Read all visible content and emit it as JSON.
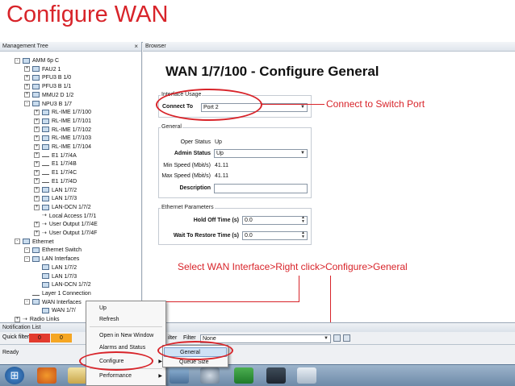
{
  "slide_title": "Configure WAN",
  "tree": {
    "header": "Management Tree",
    "close_glyph": "×",
    "items": [
      {
        "label": "AMM 6p C",
        "indent": 1,
        "exp": "-"
      },
      {
        "label": "FAU2 1",
        "indent": 2,
        "exp": "+"
      },
      {
        "label": "PFU3 B 1/0",
        "indent": 2,
        "exp": "+"
      },
      {
        "label": "PFU3 B 1/1",
        "indent": 2,
        "exp": "+"
      },
      {
        "label": "MMU2 D 1/2",
        "indent": 2,
        "exp": "+"
      },
      {
        "label": "NPU3 B 1/7",
        "indent": 2,
        "exp": "-"
      },
      {
        "label": "RL-IME 1/7/100",
        "indent": 3,
        "exp": "+"
      },
      {
        "label": "RL-IME 1/7/101",
        "indent": 3,
        "exp": "+"
      },
      {
        "label": "RL-IME 1/7/102",
        "indent": 3,
        "exp": "+"
      },
      {
        "label": "RL-IME 1/7/103",
        "indent": 3,
        "exp": "+"
      },
      {
        "label": "RL-IME 1/7/104",
        "indent": 3,
        "exp": "+"
      },
      {
        "label": "E1 1/7/4A",
        "indent": 3,
        "exp": "+",
        "icon": "line"
      },
      {
        "label": "E1 1/7/4B",
        "indent": 3,
        "exp": "+",
        "icon": "line"
      },
      {
        "label": "E1 1/7/4C",
        "indent": 3,
        "exp": "+",
        "icon": "line"
      },
      {
        "label": "E1 1/7/4D",
        "indent": 3,
        "exp": "+",
        "icon": "line"
      },
      {
        "label": "LAN 1/7/2",
        "indent": 3,
        "exp": "+"
      },
      {
        "label": "LAN 1/7/3",
        "indent": 3,
        "exp": "+"
      },
      {
        "label": "LAN-DCN 1/7/2",
        "indent": 3,
        "exp": "+"
      },
      {
        "label": "Local Access 1/7/1",
        "indent": 3,
        "exp": "",
        "icon": "arrow"
      },
      {
        "label": "User Output 1/7/4E",
        "indent": 3,
        "exp": "+",
        "icon": "arrow"
      },
      {
        "label": "User Output 1/7/4F",
        "indent": 3,
        "exp": "+",
        "icon": "arrow"
      },
      {
        "label": "Ethernet",
        "indent": 1,
        "exp": "-"
      },
      {
        "label": "Ethernet Switch",
        "indent": 2,
        "exp": "-"
      },
      {
        "label": "LAN Interfaces",
        "indent": 2,
        "exp": "-"
      },
      {
        "label": "LAN 1/7/2",
        "indent": 3,
        "exp": ""
      },
      {
        "label": "LAN 1/7/3",
        "indent": 3,
        "exp": ""
      },
      {
        "label": "LAN-DCN 1/7/2",
        "indent": 3,
        "exp": ""
      },
      {
        "label": "Layer 1 Connection",
        "indent": 2,
        "exp": "",
        "icon": "line"
      },
      {
        "label": "WAN Interfaces",
        "indent": 2,
        "exp": "-"
      },
      {
        "label": "WAN 1/7/",
        "indent": 3,
        "exp": ""
      },
      {
        "label": "Radio Links",
        "indent": 1,
        "exp": "+",
        "icon": "arrow"
      }
    ]
  },
  "browser": {
    "header": "Browser",
    "page_title": "WAN 1/7/100 - Configure General",
    "interface_usage": {
      "legend": "Interface Usage",
      "connect_to_label": "Connect To",
      "connect_to_value": "Port 2"
    },
    "general": {
      "legend": "General",
      "oper_status_label": "Oper Status",
      "oper_status_value": "Up",
      "admin_status_label": "Admin Status",
      "admin_status_value": "Up",
      "min_speed_label": "Min Speed (Mbit/s)",
      "min_speed_value": "41.11",
      "max_speed_label": "Max Speed (Mbit/s)",
      "max_speed_value": "41.11",
      "description_label": "Description",
      "description_value": ""
    },
    "ethernet_parameters": {
      "legend": "Ethernet Parameters",
      "hold_off_label": "Hold Off Time (s)",
      "hold_off_value": "0.0",
      "wait_restore_label": "Wait To Restore Time (s)",
      "wait_restore_value": "0.0"
    }
  },
  "callouts": {
    "connect": "Connect to Switch Port",
    "select": "Select WAN Interface>Right click>Configure>General"
  },
  "context_menu": {
    "items": [
      "Up",
      "Refresh",
      "Open in New Window",
      "Alarms and Status",
      "Configure",
      "Performance"
    ],
    "configure_submenu": [
      "General",
      "Queue Size"
    ]
  },
  "notification": {
    "title": "Notification List",
    "quick_filter_label": "Quick filter",
    "badge_values": [
      "0",
      "0"
    ],
    "badge_colors": [
      "#e23b2e",
      "#f5a623"
    ],
    "filter_label_1": "ilter",
    "filter_label_2": "Filter",
    "filter_value": "None"
  },
  "status": {
    "text": "Ready"
  },
  "taskbar": {
    "start_glyph": "⊞",
    "apps": [
      "firefox-icon",
      "files-icon",
      "explorer-icon",
      "app-icon",
      "settings-icon",
      "terminal-icon",
      "excel-icon",
      "window-icon"
    ]
  },
  "colors": {
    "accent_red": "#d8242a"
  }
}
